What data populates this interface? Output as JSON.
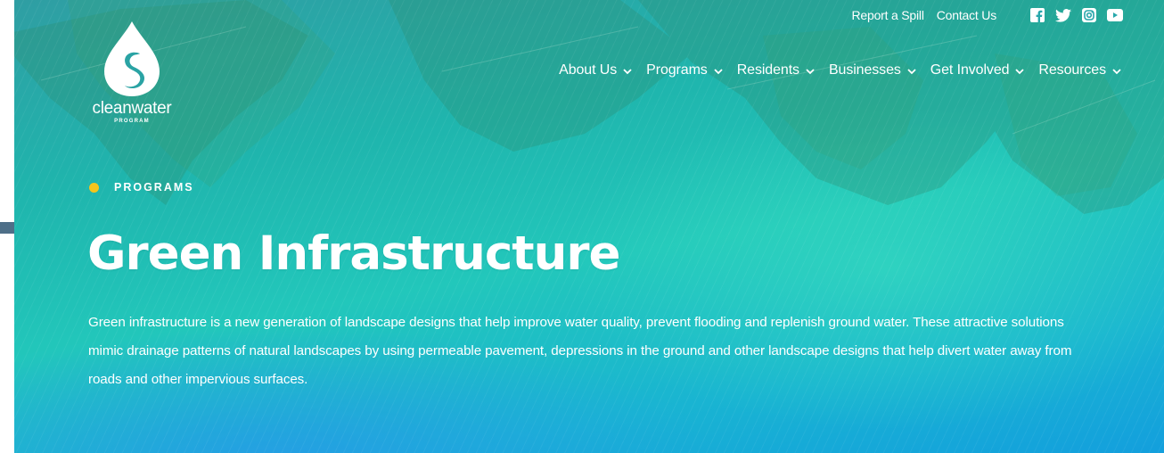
{
  "brand": {
    "logo_word": "cleanwater",
    "logo_sub": "PROGRAM"
  },
  "utility": {
    "links": [
      "Report a Spill",
      "Contact Us"
    ],
    "social_icons": [
      "facebook-icon",
      "twitter-icon",
      "instagram-icon",
      "youtube-icon"
    ]
  },
  "nav": {
    "items": [
      "About Us",
      "Programs",
      "Residents",
      "Businesses",
      "Get Involved",
      "Resources"
    ]
  },
  "hero": {
    "eyebrow": "PROGRAMS",
    "title": "Green Infrastructure",
    "description": "Green infrastructure is a new generation of landscape designs that help improve water quality, prevent flooding and replenish ground water. These attractive solutions mimic drainage patterns of natural landscapes by using permeable pavement, depressions in the ground and other landscape designs that help divert water away from roads and other impervious surfaces."
  },
  "colors": {
    "accent_dot": "#f5c51b",
    "hero_teal": "#22c7bb",
    "hero_blue": "#139fdd",
    "text": "#ffffff"
  }
}
